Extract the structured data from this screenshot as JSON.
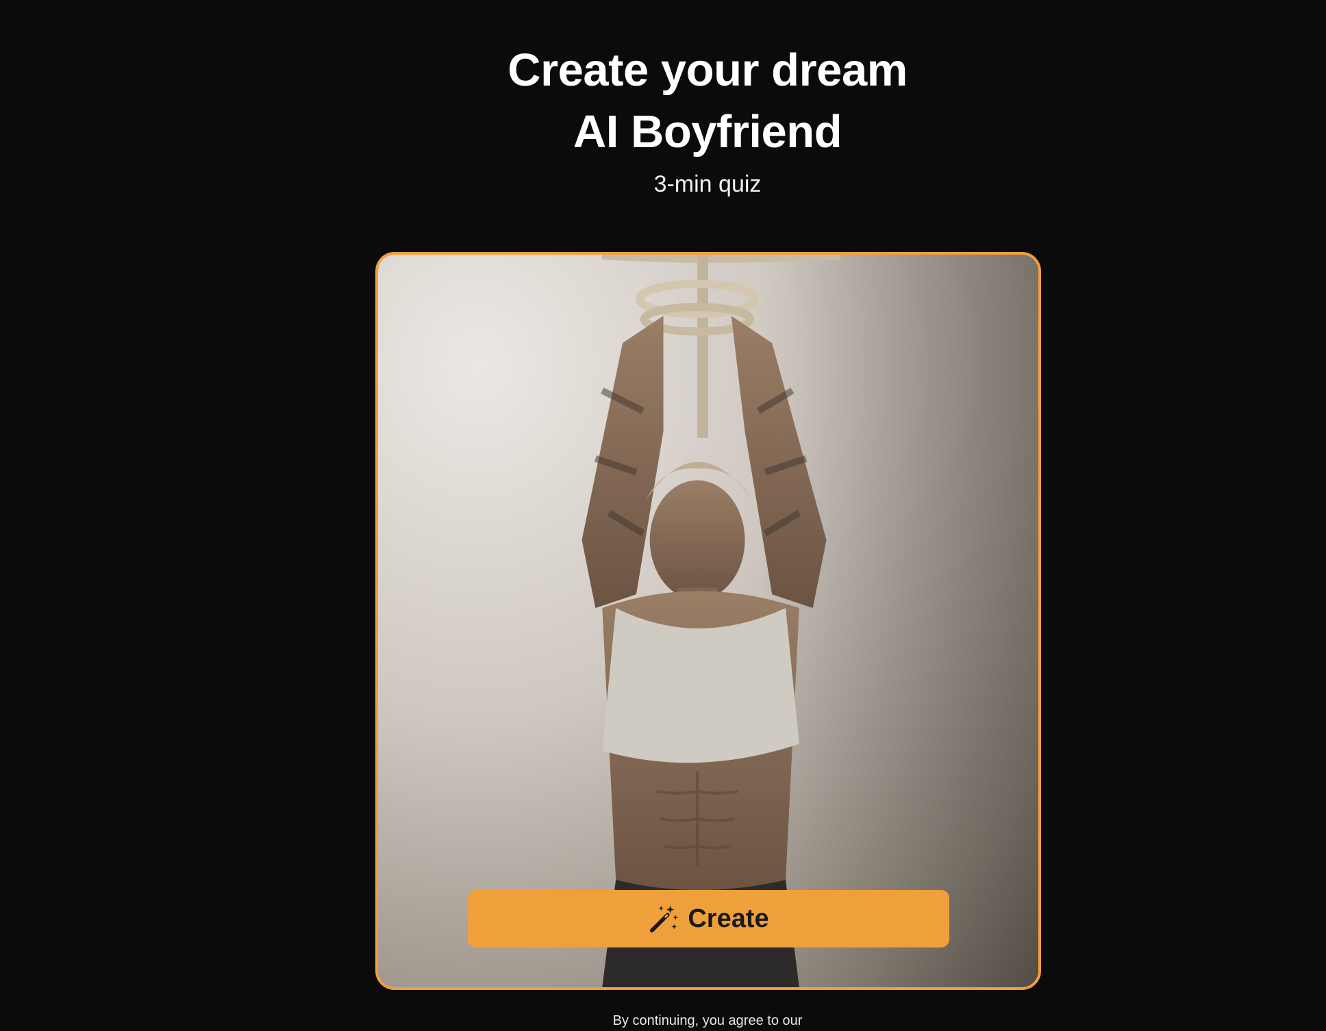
{
  "hero": {
    "title_line1": "Create your dream",
    "title_line2": "AI Boyfriend",
    "subtitle": "3-min quiz"
  },
  "card": {
    "image_alt": "AI boyfriend preview photo",
    "button_label": "Create",
    "button_icon": "magic-wand-icon"
  },
  "footer": {
    "legal_text": "By continuing, you agree to our"
  },
  "colors": {
    "background": "#0b0b0b",
    "accent": "#f0a03a",
    "text": "#ffffff"
  }
}
